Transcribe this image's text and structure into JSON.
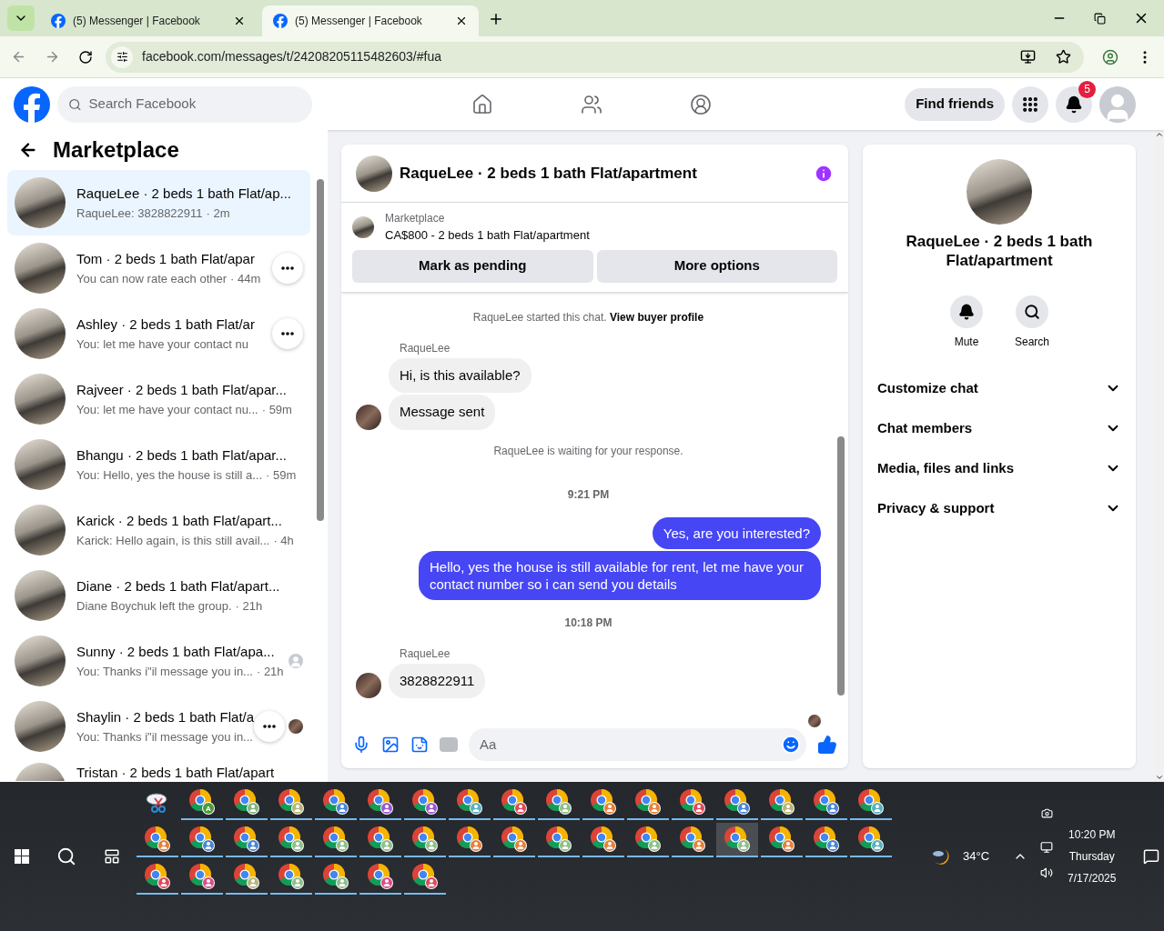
{
  "browser": {
    "tabs": [
      {
        "title": "(5) Messenger | Facebook",
        "selected": false
      },
      {
        "title": "(5) Messenger | Facebook",
        "selected": true
      }
    ],
    "url": "facebook.com/messages/t/24208205115482603/#fua"
  },
  "header": {
    "search": {
      "placeholder": "Search Facebook"
    },
    "nav": [
      {
        "kind": "home",
        "selected": false
      },
      {
        "kind": "friends",
        "selected": false
      },
      {
        "kind": "groups",
        "selected": false
      }
    ],
    "find_friends": "Find friends",
    "notification_count": "5"
  },
  "sidebar": {
    "title": "Marketplace",
    "chats": [
      {
        "title": "RaqueLee · 2 beds 1 bath Flat/ap...",
        "preview": "RaqueLee: 3828822911",
        "time": "· 2m",
        "selected": true,
        "more": false
      },
      {
        "title": "Tom · 2 beds 1 bath Flat/apar",
        "preview": "You can now rate each other",
        "time": "· 44m",
        "selected": false,
        "more": true
      },
      {
        "title": "Ashley · 2 beds 1 bath Flat/ar",
        "preview": "You: let me have your contact nu",
        "selected": false,
        "more": true
      },
      {
        "title": "Rajveer · 2 beds 1 bath Flat/apar...",
        "preview": "You: let me have your contact nu...",
        "time": "· 59m",
        "selected": false,
        "more": false
      },
      {
        "title": "Bhangu · 2 beds 1 bath Flat/apar...",
        "preview": "You: Hello, yes the house is still a...",
        "time": "· 59m",
        "selected": false,
        "more": false
      },
      {
        "title": "Karick · 2 beds 1 bath Flat/apart...",
        "preview": "Karick: Hello again, is this still avail...",
        "time": "· 4h",
        "selected": false,
        "more": false
      },
      {
        "title": "Diane · 2 beds 1 bath Flat/apart...",
        "preview": "Diane Boychuk left the group.",
        "time": "· 21h",
        "selected": false,
        "more": false
      },
      {
        "title": "Sunny · 2 beds 1 bath Flat/apa...",
        "preview": "You: Thanks i\"il message you in...",
        "time": "· 21h",
        "selected": false,
        "more": false,
        "seen": {
          "kind": "generic"
        }
      },
      {
        "title": "Shaylin · 2 beds 1 bath Flat/a",
        "preview": "You: Thanks i\"il message you in...",
        "selected": false,
        "more": true,
        "seen": {
          "kind": "photo"
        }
      },
      {
        "title": "Tristan · 2 beds 1 bath Flat/apart",
        "selected": false,
        "more": false
      }
    ]
  },
  "chat": {
    "title": "RaqueLee · 2 beds 1 bath Flat/apartment",
    "listing": {
      "label": "Marketplace",
      "text": "CA$800 - 2 beds 1 bath Flat/apartment",
      "buttons": [
        "Mark as pending",
        "More options"
      ]
    },
    "messages": [
      {
        "kind": "notice",
        "text": "RaqueLee started this chat.",
        "link": "View buyer profile"
      },
      {
        "kind": "incoming",
        "sender": "RaqueLee",
        "bubbles": [
          "Hi, is this available?",
          "Message sent"
        ]
      },
      {
        "kind": "notice",
        "text": "RaqueLee is waiting for your response."
      },
      {
        "kind": "time",
        "text": "9:21 PM"
      },
      {
        "kind": "outgoing",
        "bubbles": [
          "Yes, are you interested?",
          "Hello, yes the house is still available for rent, let me have your contact number so i can send you details"
        ]
      },
      {
        "kind": "time",
        "text": "10:18 PM"
      },
      {
        "kind": "incoming",
        "sender": "RaqueLee",
        "bubbles": [
          "3828822911"
        ]
      }
    ],
    "composer": {
      "placeholder": "Aa"
    }
  },
  "details": {
    "name": "RaqueLee · 2 beds 1 bath Flat/apartment",
    "actions": [
      {
        "kind": "mute",
        "label": "Mute"
      },
      {
        "kind": "search",
        "label": "Search"
      }
    ],
    "sections": [
      {
        "label": "Customize chat",
        "expanded": false
      },
      {
        "label": "Chat members",
        "expanded": false
      },
      {
        "label": "Media, files and links",
        "expanded": false
      },
      {
        "label": "Privacy & support",
        "expanded": false
      }
    ]
  },
  "taskbar": {
    "apps": [
      {
        "kind": "snip",
        "selected": false
      },
      {
        "kind": "chrome",
        "color": "#4c9a3a",
        "letter": "A",
        "selected": false
      },
      {
        "kind": "chrome",
        "color": "#7fb77e",
        "selected": false
      },
      {
        "kind": "chrome",
        "color": "#b9b57a",
        "selected": false
      },
      {
        "kind": "chrome",
        "color": "#4a86d8",
        "selected": false
      },
      {
        "kind": "chrome",
        "color": "#9b59d0",
        "selected": false
      },
      {
        "kind": "chrome",
        "color": "#9b59d0",
        "selected": false
      },
      {
        "kind": "chrome",
        "color": "#5bb0c0",
        "selected": false
      },
      {
        "kind": "chrome",
        "color": "#e04a5a",
        "selected": false
      },
      {
        "kind": "chrome",
        "color": "#8fbf8a",
        "selected": false
      },
      {
        "kind": "chrome",
        "color": "#e8803a",
        "selected": false
      },
      {
        "kind": "chrome",
        "color": "#e8803a",
        "selected": false
      },
      {
        "kind": "chrome",
        "color": "#e04a5a",
        "selected": false
      },
      {
        "kind": "chrome",
        "color": "#4a86d8",
        "selected": false
      },
      {
        "kind": "chrome",
        "color": "#b9b57a",
        "selected": false
      },
      {
        "kind": "chrome",
        "color": "#4a86d8",
        "selected": false
      },
      {
        "kind": "chrome",
        "color": "#5bb0c0",
        "selected": false
      },
      {
        "kind": "chrome",
        "color": "#e8803a",
        "selected": false
      },
      {
        "kind": "chrome",
        "color": "#4a86d8",
        "selected": false
      },
      {
        "kind": "chrome",
        "color": "#4a86d8",
        "selected": false
      },
      {
        "kind": "chrome",
        "color": "#8fbf8a",
        "selected": false
      },
      {
        "kind": "chrome",
        "color": "#8fbf8a",
        "selected": false
      },
      {
        "kind": "chrome",
        "color": "#8fbf8a",
        "selected": false
      },
      {
        "kind": "chrome",
        "color": "#8fbf8a",
        "selected": false
      },
      {
        "kind": "chrome",
        "color": "#e8803a",
        "selected": false
      },
      {
        "kind": "chrome",
        "color": "#e8803a",
        "selected": false
      },
      {
        "kind": "chrome",
        "color": "#8fbf8a",
        "selected": false
      },
      {
        "kind": "chrome",
        "color": "#e8803a",
        "selected": false
      },
      {
        "kind": "chrome",
        "color": "#8fbf8a",
        "selected": false
      },
      {
        "kind": "chrome",
        "color": "#e8803a",
        "selected": false
      },
      {
        "kind": "chrome",
        "color": "#8fbf8a",
        "selected": true
      },
      {
        "kind": "chrome",
        "color": "#e8803a",
        "selected": false
      },
      {
        "kind": "chrome",
        "color": "#4a86d8",
        "selected": false
      },
      {
        "kind": "chrome",
        "color": "#5bb0c0",
        "selected": false
      },
      {
        "kind": "chrome",
        "color": "#e04a5a",
        "selected": false
      },
      {
        "kind": "chrome",
        "color": "#e04a8a",
        "selected": false
      },
      {
        "kind": "chrome",
        "color": "#b9b57a",
        "selected": false
      },
      {
        "kind": "chrome",
        "color": "#8fbf8a",
        "selected": false
      },
      {
        "kind": "chrome",
        "color": "#8fbf8a",
        "selected": false
      },
      {
        "kind": "chrome",
        "color": "#e04a8a",
        "selected": false
      },
      {
        "kind": "chrome",
        "color": "#e04a5a",
        "selected": false
      }
    ],
    "weather": "34°C",
    "time": "10:20 PM",
    "day": "Thursday",
    "date": "7/17/2025"
  }
}
